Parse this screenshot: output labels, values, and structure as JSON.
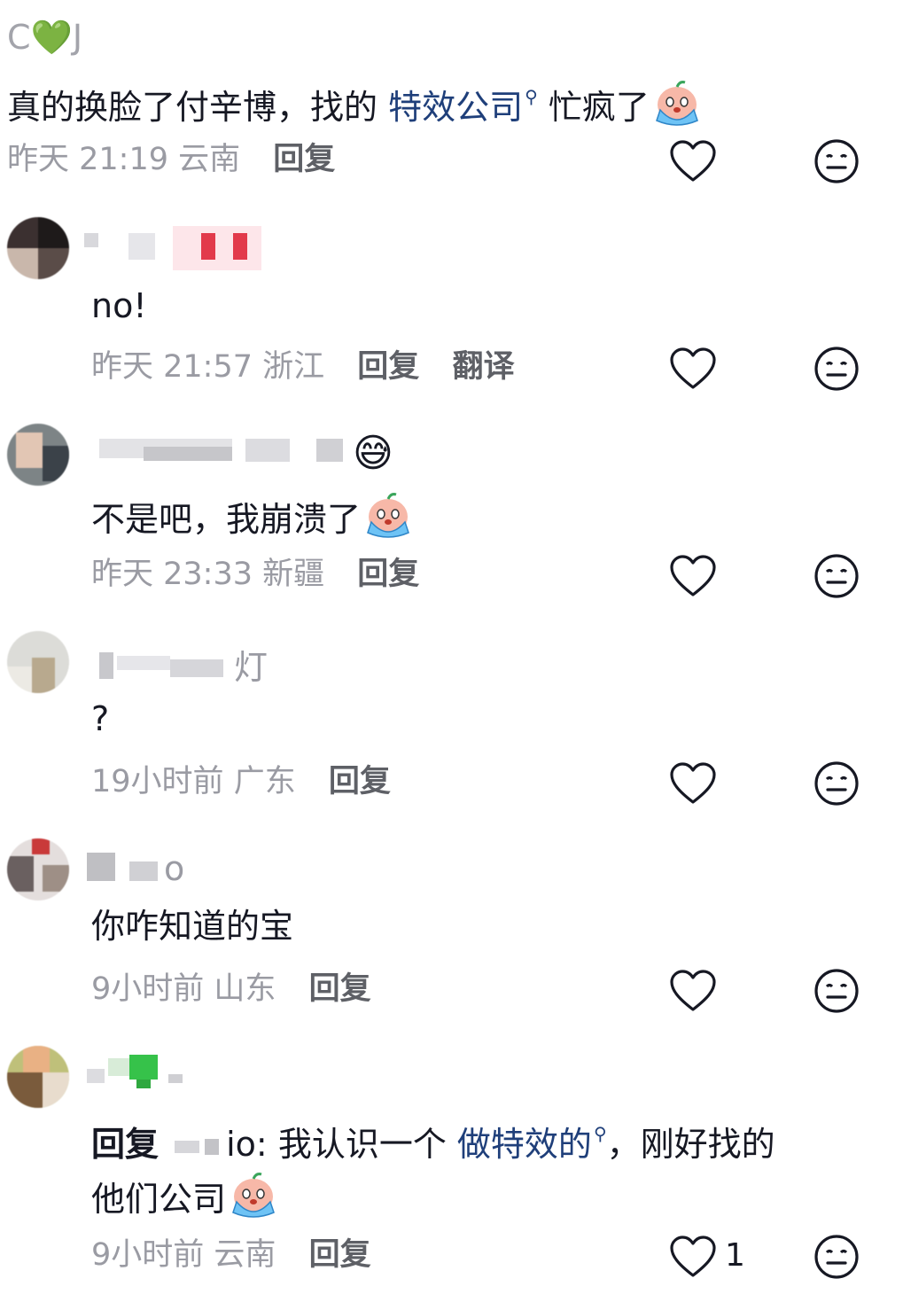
{
  "comments": [
    {
      "username": "C💚J",
      "text_before": "真的换脸了付辛博，找的",
      "link": "特效公司",
      "text_after": "忙疯了",
      "time": "昨天 21:19",
      "location": "云南",
      "reply_label": "回复"
    },
    {
      "username": "",
      "text": "no!",
      "time": "昨天 21:57",
      "location": "浙江",
      "reply_label": "回复",
      "translate_label": "翻译"
    },
    {
      "username": "",
      "text": "不是吧，我崩溃了",
      "time": "昨天 23:33",
      "location": "新疆",
      "reply_label": "回复"
    },
    {
      "username_visible": "灯",
      "text": "?",
      "time": "19小时前",
      "location": "广东",
      "reply_label": "回复"
    },
    {
      "username_visible": "o",
      "text": "你咋知道的宝",
      "time": "9小时前",
      "location": "山东",
      "reply_label": "回复"
    },
    {
      "username": "",
      "reply_prefix": "回复",
      "reply_target_visible": "io:",
      "text_before": "我认识一个",
      "link": "做特效的",
      "text_after": "，刚好找的",
      "text_line2": "他们公司",
      "time": "9小时前",
      "location": "云南",
      "reply_label": "回复",
      "like_count": "1"
    }
  ],
  "icons": {
    "like": "heart-outline-icon",
    "dislike": "neutral-face-icon",
    "search_hint": "magnifier-icon",
    "emoji_cry": "crying-emoji-icon",
    "emoji_sweat": "sweat-smile-emoji-icon"
  },
  "colors": {
    "link": "#1f3f7a",
    "meta": "#9a9ba3",
    "text": "#161823",
    "heart_green": "#2ecc40"
  }
}
